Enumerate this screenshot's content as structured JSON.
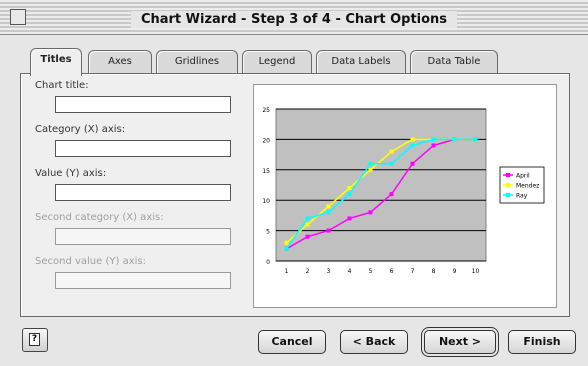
{
  "window": {
    "title": "Chart Wizard - Step 3 of 4 - Chart Options"
  },
  "tabs": [
    {
      "label": "Titles",
      "active": true
    },
    {
      "label": "Axes"
    },
    {
      "label": "Gridlines"
    },
    {
      "label": "Legend"
    },
    {
      "label": "Data Labels"
    },
    {
      "label": "Data Table"
    }
  ],
  "fields": [
    {
      "label": "Chart title:",
      "value": "",
      "disabled": false
    },
    {
      "label": "Category (X) axis:",
      "value": "",
      "disabled": false
    },
    {
      "label": "Value (Y) axis:",
      "value": "",
      "disabled": false
    },
    {
      "label": "Second category (X) axis:",
      "value": "",
      "disabled": true
    },
    {
      "label": "Second value (Y) axis:",
      "value": "",
      "disabled": true
    }
  ],
  "buttons": {
    "cancel": "Cancel",
    "back": "< Back",
    "next": "Next >",
    "finish": "Finish"
  },
  "chart_data": {
    "type": "line",
    "x": [
      1,
      2,
      3,
      4,
      5,
      6,
      7,
      8,
      9,
      10
    ],
    "ylim": [
      0,
      25
    ],
    "yticks": [
      0,
      5,
      10,
      15,
      20,
      25
    ],
    "grid": true,
    "legend_position": "right",
    "series": [
      {
        "name": "April",
        "color": "#ff00ff",
        "values": [
          2,
          4,
          5,
          7,
          8,
          11,
          16,
          19,
          20,
          20
        ]
      },
      {
        "name": "Mendez",
        "color": "#ffff00",
        "values": [
          3,
          6,
          9,
          12,
          15,
          18,
          20,
          20,
          20,
          20
        ]
      },
      {
        "name": "Ray",
        "color": "#00ffff",
        "values": [
          2,
          7,
          8,
          11,
          16,
          16,
          19,
          20,
          20,
          20
        ]
      }
    ]
  }
}
